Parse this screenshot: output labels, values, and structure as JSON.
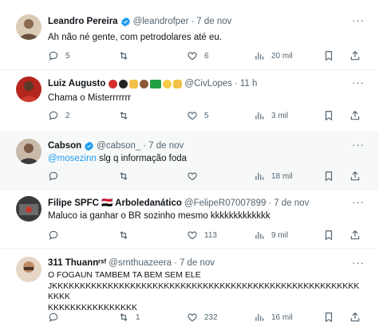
{
  "tweets": [
    {
      "name": "Leandro Pereira",
      "verified": true,
      "handle": "@leandrofper",
      "time": "7 de nov",
      "text": "Ah não né gente, com petrodolares até eu.",
      "mention": "",
      "replies": "5",
      "retweets": "",
      "likes": "6",
      "views": "20 mil"
    },
    {
      "name": "Luiz Augusto",
      "verified": false,
      "handle": "@CivLopes",
      "time": "11 h",
      "text": "Chama o Misterrrrrrr",
      "mention": "",
      "replies": "2",
      "retweets": "",
      "likes": "5",
      "views": "3 mil"
    },
    {
      "name": "Cabson",
      "verified": true,
      "handle": "@cabson_",
      "time": "7 de nov",
      "mention": "@mosezinn",
      "text": " slg q informação foda",
      "replies": "",
      "retweets": "",
      "likes": "",
      "views": "18 mil"
    },
    {
      "name": "Filipe SPFC 🇪🇬 Arboledanático",
      "verified": false,
      "handle": "@FelipeR07007899",
      "time": "7 de nov",
      "text": "Maluco ia ganhar o BR sozinho mesmo kkkkkkkkkkkkk",
      "mention": "",
      "replies": "",
      "retweets": "",
      "likes": "113",
      "views": "9 mil"
    },
    {
      "name": "311 Thuannʳˢᶠ",
      "verified": false,
      "handle": "@srnthuazeera",
      "time": "7 de nov",
      "text": "O FOGAUN TAMBEM TA BEM SEM ELE\nJKKKKKKKKKKKKKKKKKKKKKKKKKKKKKKKKKKKKKKKKKKKKKKKKKKKKKKKKKKK\nKKKKKKKKKKKKKKKK",
      "mention": "",
      "replies": "",
      "retweets": "1",
      "likes": "232",
      "views": "16 mil"
    }
  ],
  "more_label": "···",
  "colors": {
    "accent": "#1d9bf0",
    "text": "#0f1419",
    "secondary": "#536471",
    "highlight_bg": "#f7f9f9",
    "divider": "#eff3f4"
  },
  "icons": [
    "verified-badge-icon",
    "reply-icon",
    "retweet-icon",
    "like-icon",
    "views-icon",
    "bookmark-icon",
    "share-icon",
    "more-icon"
  ]
}
